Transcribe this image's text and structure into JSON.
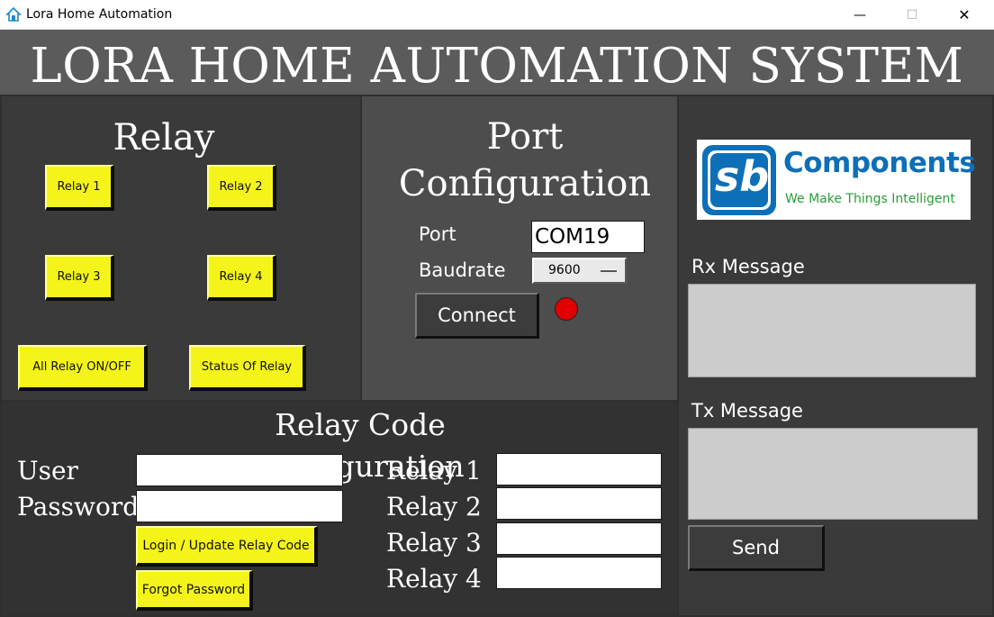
{
  "window": {
    "title": "Lora Home Automation",
    "minimize": "—",
    "maximize": "☐",
    "close": "✕"
  },
  "header": {
    "title": "LORA HOME AUTOMATION SYSTEM"
  },
  "relay_panel": {
    "title": "Relay",
    "buttons": [
      "Relay 1",
      "Relay 2",
      "Relay 3",
      "Relay 4"
    ],
    "all_relay": "All Relay ON/OFF",
    "status": "Status Of Relay"
  },
  "port_panel": {
    "title": "Port Configuration",
    "port_label": "Port",
    "port_value": "COM19",
    "baud_label": "Baudrate",
    "baud_value": "9600",
    "connect": "Connect",
    "status_color": "#e00000"
  },
  "logo": {
    "brand": "sb",
    "name": "Components",
    "tagline": "We Make Things Intelligent",
    "blue": "#0d6fb8",
    "green": "#2a9d3a"
  },
  "messages": {
    "rx_label": "Rx Message",
    "tx_label": "Tx Message",
    "send": "Send"
  },
  "code_panel": {
    "title": "Relay Code Configuration",
    "user_label": "User",
    "password_label": "Password",
    "login_button": "Login / Update Relay Code",
    "forgot_button": "Forgot Password",
    "relay_labels": [
      "Relay 1",
      "Relay 2",
      "Relay 3",
      "Relay 4"
    ]
  }
}
